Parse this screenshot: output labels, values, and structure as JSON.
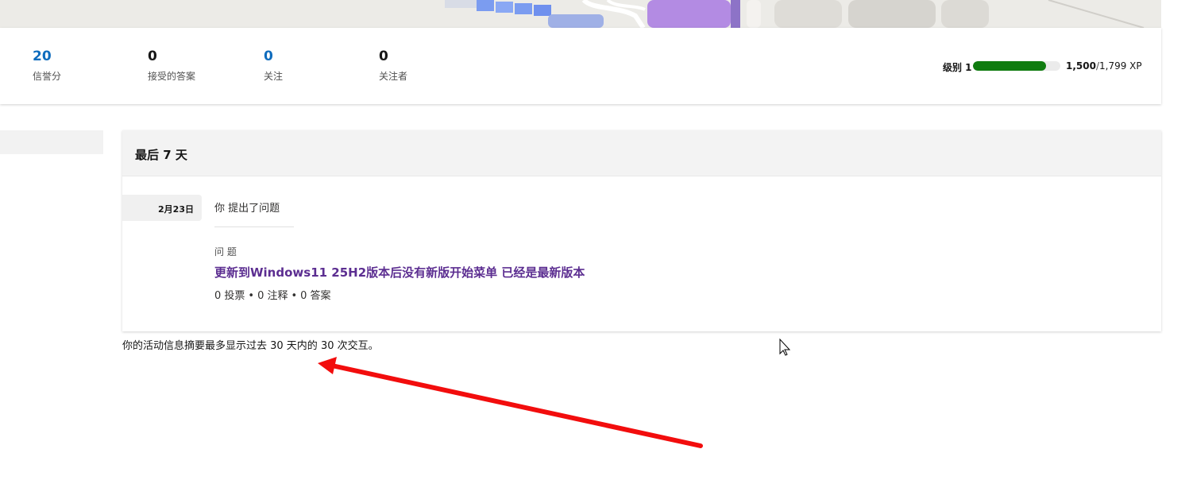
{
  "stats": [
    {
      "value": "20",
      "label": "信誉分",
      "color": "#0f6cbd"
    },
    {
      "value": "0",
      "label": "接受的答案",
      "color": "#161616"
    },
    {
      "value": "0",
      "label": "关注",
      "color": "#0f6cbd"
    },
    {
      "value": "0",
      "label": "关注者",
      "color": "#161616"
    }
  ],
  "level": {
    "label": "级别 1",
    "xp_current": "1,500",
    "xp_sep": "/",
    "xp_max": "1,799 XP",
    "progress_fraction": 0.834,
    "bar_color": "#107c10"
  },
  "activity": {
    "header": "最后 7 天",
    "date": "2月23日",
    "action": "你 提出了问题",
    "type_label": "问 题",
    "question_title": "更新到Windows11 25H2版本后没有新版开始菜单 已经是最新版本",
    "meta": {
      "votes": "0 投票",
      "comments": "0 注释",
      "answers": "0 答案",
      "dot": "•"
    }
  },
  "footnote": "你的活动信息摘要最多显示过去 30 天内的 30 次交互。",
  "colors": {
    "accent_blue": "#0f6cbd",
    "link_purple": "#5c2e91",
    "annotation_red": "#f20d0d"
  }
}
